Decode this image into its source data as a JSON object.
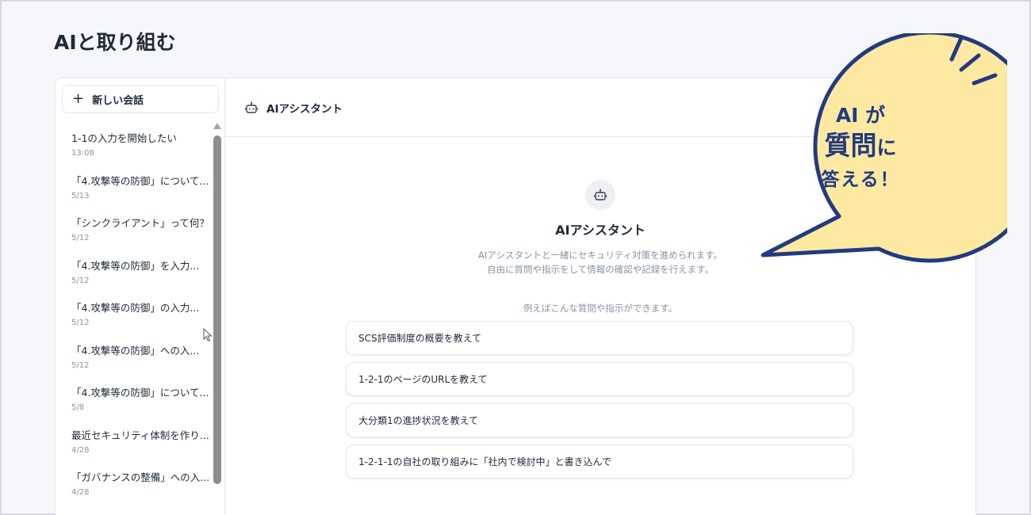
{
  "page": {
    "title": "AIと取り組む"
  },
  "sidebar": {
    "new_chat_label": "新しい会話",
    "conversations": [
      {
        "title": "1-1の入力を開始したい",
        "date": "13:08"
      },
      {
        "title": "「4.攻撃等の防御」について...",
        "date": "5/13"
      },
      {
        "title": "「シンクライアント」って何？",
        "date": "5/12"
      },
      {
        "title": "「4.攻撃等の防御」を入力...",
        "date": "5/12"
      },
      {
        "title": "「4.攻撃等の防御」の入力...",
        "date": "5/12"
      },
      {
        "title": "「4.攻撃等の防御」への入...",
        "date": "5/12"
      },
      {
        "title": "「4.攻撃等の防御」について...",
        "date": "5/8"
      },
      {
        "title": "最近セキュリティ体制を作り...",
        "date": "4/28"
      },
      {
        "title": "「ガバナンスの整備」への入...",
        "date": "4/28"
      }
    ]
  },
  "main": {
    "header_title": "AIアシスタント",
    "welcome_title": "AIアシスタント",
    "welcome_desc_1": "AIアシスタントと一緒にセキュリティ対策を進められます。",
    "welcome_desc_2": "自由に質問や指示をして情報の確認や記録を行えます。",
    "examples_label": "例えばこんな質問や指示ができます。",
    "suggestions": [
      "SCS評価制度の概要を教えて",
      "1-2-1のページのURLを教えて",
      "大分類1の進捗状況を教えて",
      "1-2-1-1の自社の取り組みに「社内で検討中」と書き込んで"
    ]
  },
  "callout": {
    "line1": "AI が",
    "line2_big": "質問",
    "line2_small": "に",
    "line3": "答える！"
  },
  "colors": {
    "bubble_fill": "#fde9a2",
    "bubble_stroke": "#233a80",
    "scrollbar": "#8d8d8d"
  }
}
